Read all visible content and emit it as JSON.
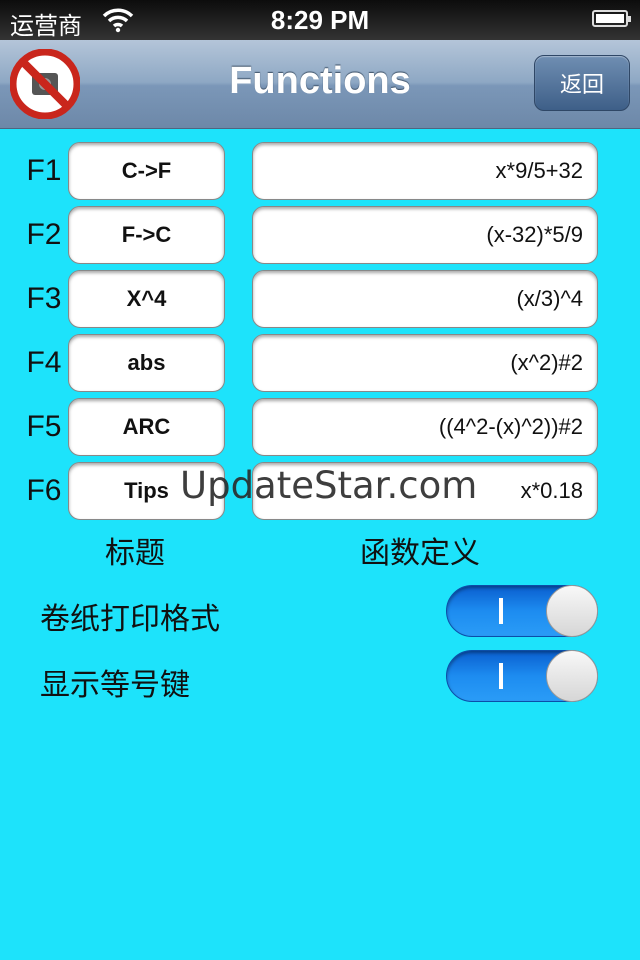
{
  "status_bar": {
    "carrier": "运营商",
    "time": "8:29 PM"
  },
  "nav": {
    "title": "Functions",
    "back_label": "返回"
  },
  "functions": [
    {
      "label": "F1",
      "title": "C->F",
      "definition": "x*9/5+32"
    },
    {
      "label": "F2",
      "title": "F->C",
      "definition": "(x-32)*5/9"
    },
    {
      "label": "F3",
      "title": "X^4",
      "definition": "(x/3)^4"
    },
    {
      "label": "F4",
      "title": "abs",
      "definition": "(x^2)#2"
    },
    {
      "label": "F5",
      "title": "ARC",
      "definition": "((4^2-(x)^2))#2"
    },
    {
      "label": "F6",
      "title": "Tips",
      "definition": "x*0.18"
    }
  ],
  "columns": {
    "title_header": "标题",
    "definition_header": "函数定义"
  },
  "settings": [
    {
      "label": "卷纸打印格式",
      "on": true
    },
    {
      "label": "显示等号键",
      "on": true
    }
  ],
  "watermark": "UpdateStar.com",
  "colors": {
    "background": "#1de3fb",
    "toggle_on": "#1d8cf0"
  }
}
